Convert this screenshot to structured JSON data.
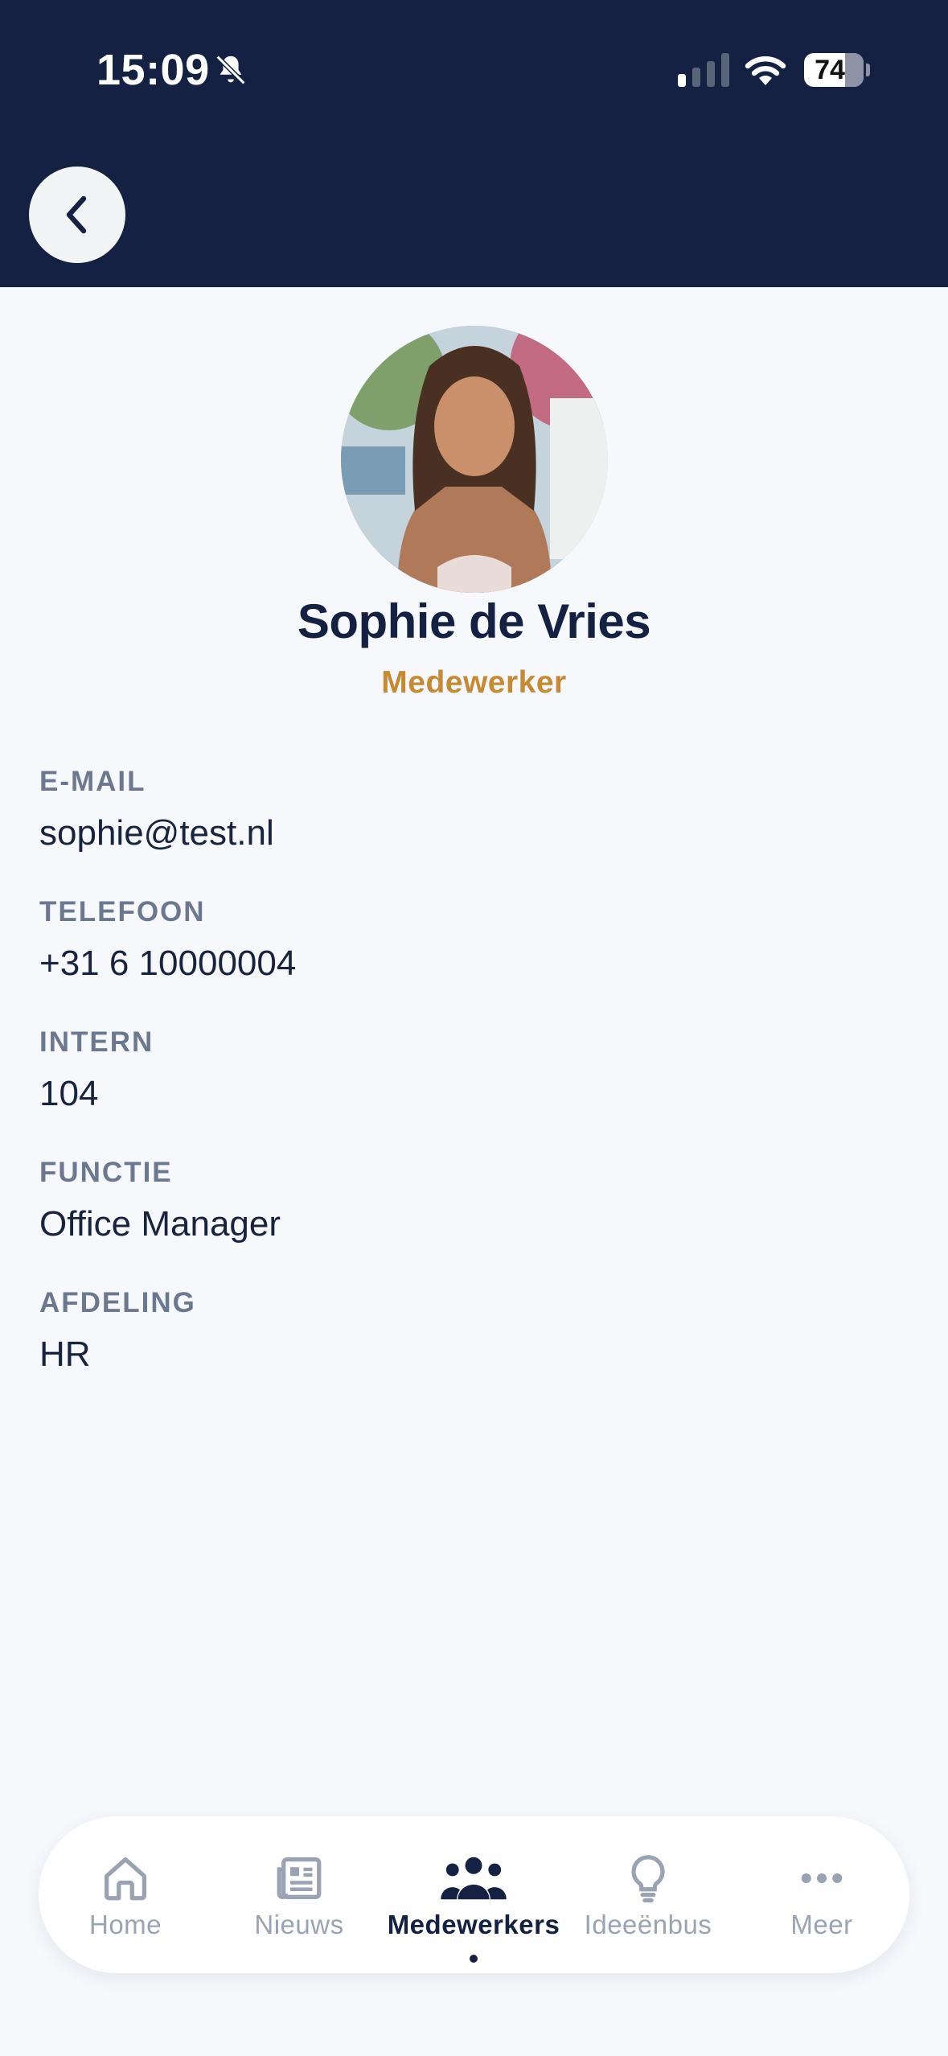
{
  "status_bar": {
    "time": "15:09",
    "battery": "74"
  },
  "profile": {
    "name": "Sophie de Vries",
    "role": "Medewerker"
  },
  "fields": [
    {
      "label": "E-MAIL",
      "value": "sophie@test.nl"
    },
    {
      "label": "TELEFOON",
      "value": "+31 6 10000004"
    },
    {
      "label": "INTERN",
      "value": "104"
    },
    {
      "label": "FUNCTIE",
      "value": "Office Manager"
    },
    {
      "label": "AFDELING",
      "value": "HR"
    }
  ],
  "tabs": [
    {
      "label": "Home",
      "icon": "home-icon",
      "active": false
    },
    {
      "label": "Nieuws",
      "icon": "newspaper-icon",
      "active": false
    },
    {
      "label": "Medewerkers",
      "icon": "people-icon",
      "active": true
    },
    {
      "label": "Ideeënbus",
      "icon": "lightbulb-icon",
      "active": false
    },
    {
      "label": "Meer",
      "icon": "more-icon",
      "active": false
    }
  ],
  "colors": {
    "header": "#142143",
    "accent": "#c48b34",
    "background": "#f6f8fc"
  }
}
